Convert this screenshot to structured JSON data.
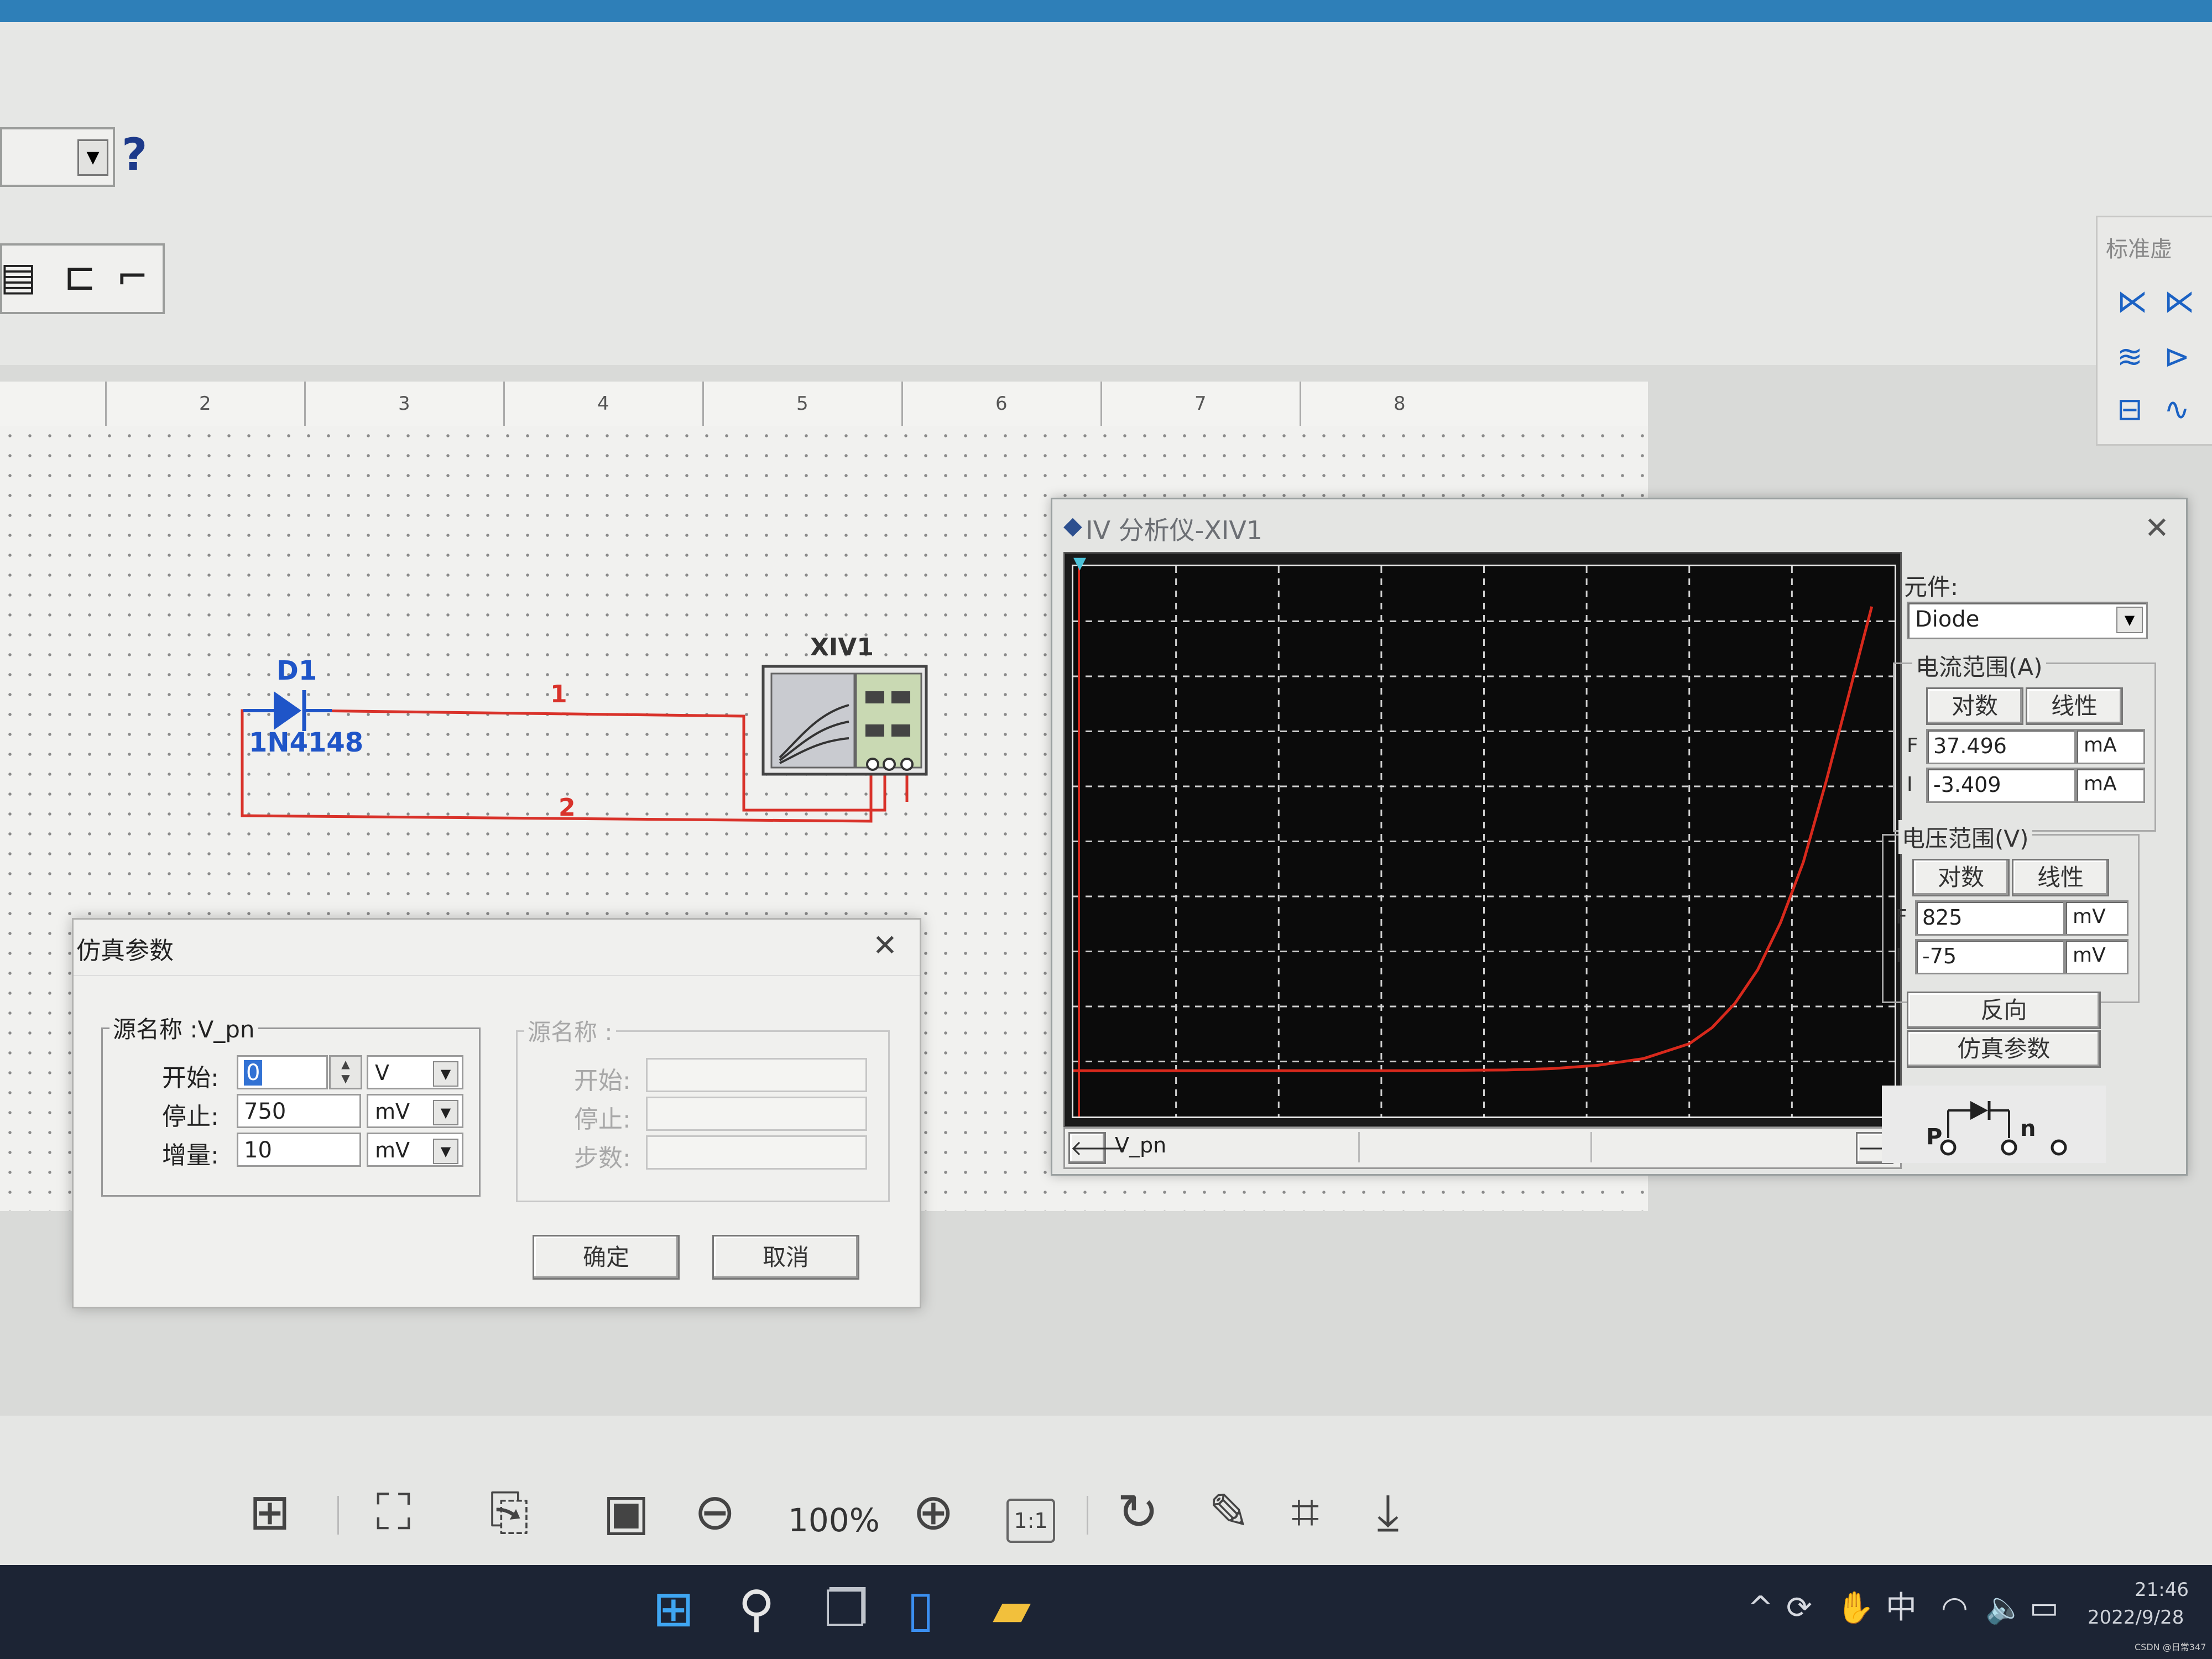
{
  "toolbar": {
    "help_glyph": "?"
  },
  "ruler": {
    "marks": [
      "2",
      "3",
      "4",
      "5",
      "6",
      "7",
      "8"
    ]
  },
  "palette": {
    "title": "标准虚"
  },
  "schematic": {
    "diode_ref": "D1",
    "diode_model": "1N4148",
    "net1": "1",
    "net2": "2",
    "instrument_ref": "XIV1"
  },
  "iv_analyzer": {
    "title": "IV 分析仪-XIV1",
    "component_label": "元件:",
    "component_value": "Diode",
    "current_range": {
      "title": "电流范围(A)",
      "log_label": "对数",
      "linear_label": "线性",
      "f_label": "F",
      "f_value": "37.496",
      "f_unit": "mA",
      "i_label": "I",
      "i_value": "-3.409",
      "i_unit": "mA"
    },
    "voltage_range": {
      "title": "电压范围(V)",
      "log_label": "对数",
      "linear_label": "线性",
      "f_label": "F",
      "f_value": "825",
      "f_unit": "mV",
      "i_label": "I",
      "i_value": "-75",
      "i_unit": "mV"
    },
    "reverse_label": "反向",
    "sim_params_label": "仿真参数",
    "nav_label": "V_pn",
    "symbol_p": "P",
    "symbol_n": "n",
    "curve_color": "#d8291c"
  },
  "chart_data": {
    "type": "line",
    "series": [
      {
        "x": [
          -75,
          0,
          100,
          200,
          300,
          400,
          450,
          500,
          550,
          600,
          625,
          650,
          675,
          700,
          725,
          750,
          775,
          800
        ],
        "y": [
          0,
          0,
          0,
          0,
          0,
          0.05,
          0.15,
          0.4,
          0.9,
          2.0,
          3.2,
          5.0,
          7.5,
          11.0,
          15.5,
          21.5,
          28.0,
          34.5
        ]
      }
    ],
    "xlim": [
      -75,
      825
    ],
    "ylim": [
      -3.409,
      37.496
    ],
    "grid": true,
    "xlabel": "",
    "ylabel": "",
    "title": ""
  },
  "sim_dialog": {
    "title": "仿真参数",
    "source_title": "源名称 :V_pn",
    "start_label": "开始:",
    "start_value": "0",
    "start_unit": "V",
    "stop_label": "停止:",
    "stop_value": "750",
    "stop_unit": "mV",
    "step_label": "增量:",
    "step_value": "10",
    "step_unit": "mV",
    "source2_title": "源名称 :",
    "start2_label": "开始:",
    "stop2_label": "停止:",
    "steps2_label": "步数:",
    "ok_label": "确定",
    "cancel_label": "取消"
  },
  "photo_bar": {
    "zoom": "100%",
    "one_to_one": "1:1"
  },
  "tray": {
    "ime": "中",
    "time": "21:46",
    "date": "2022/9/28",
    "watermark": "CSDN @日常347"
  }
}
